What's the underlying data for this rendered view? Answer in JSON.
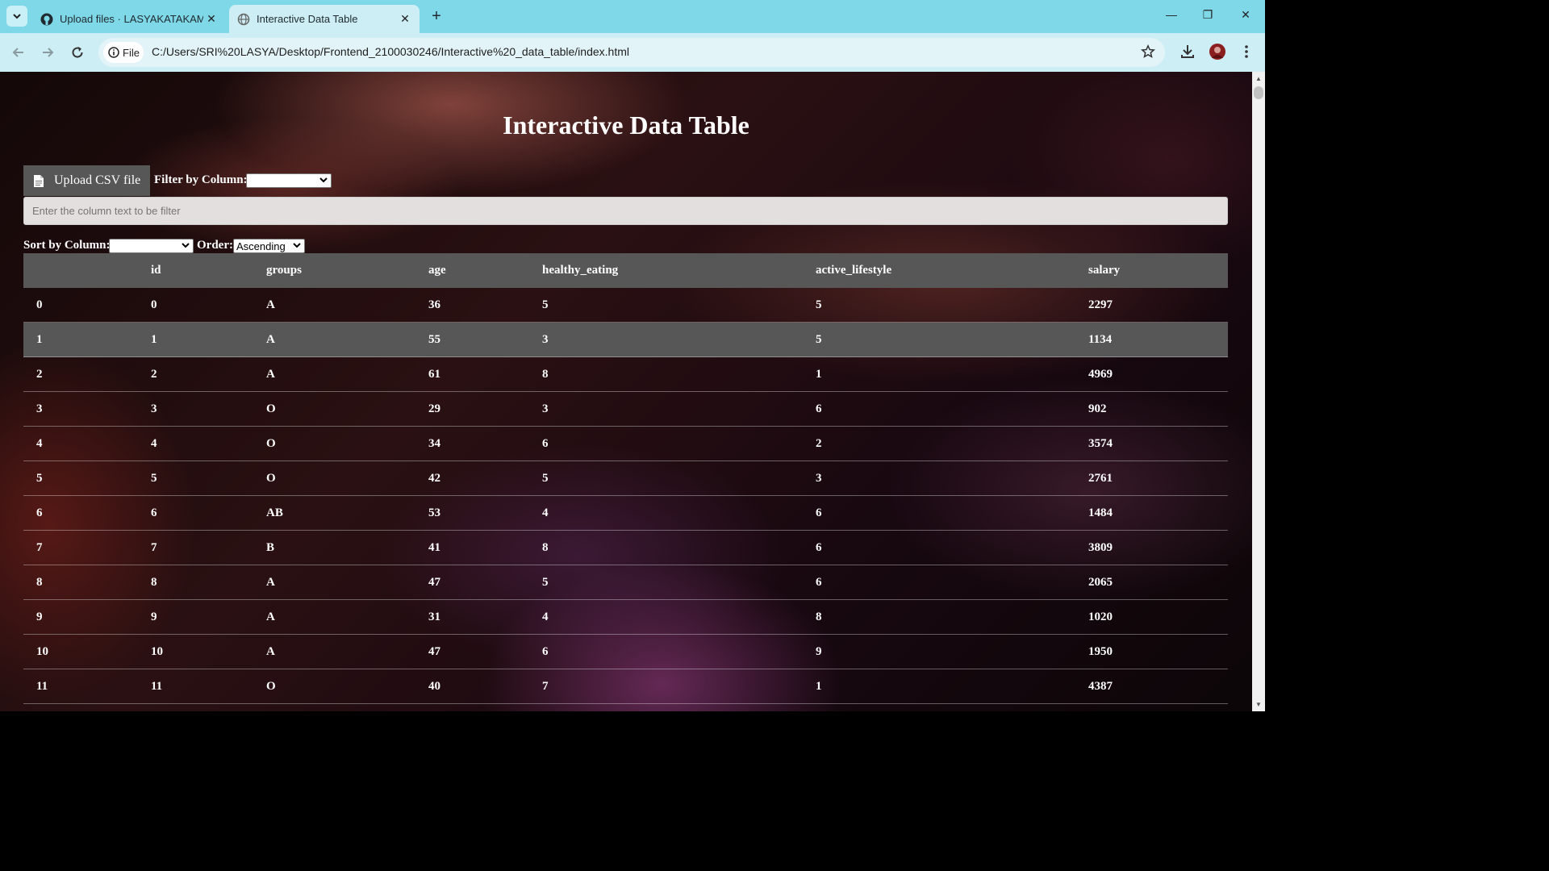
{
  "browser": {
    "tabs": [
      {
        "title": "Upload files · LASYAKATAKAM/F",
        "active": false
      },
      {
        "title": "Interactive Data Table",
        "active": true
      }
    ],
    "address_chip": "File",
    "url": "C:/Users/SRI%20LASYA/Desktop/Frontend_2100030246/Interactive%20_data_table/index.html"
  },
  "page": {
    "title": "Interactive Data Table",
    "upload_label": "Upload CSV file",
    "filter_label": "Filter by Column:",
    "filter_selected": "",
    "filter_placeholder": "Enter the column text to be filter",
    "sort_label": "Sort by Column:",
    "sort_selected": "",
    "order_label": "Order:",
    "order_selected": "Ascending"
  },
  "table": {
    "headers": [
      "",
      "id",
      "groups",
      "age",
      "healthy_eating",
      "active_lifestyle",
      "salary"
    ],
    "rows": [
      [
        "0",
        "0",
        "A",
        "36",
        "5",
        "5",
        "2297"
      ],
      [
        "1",
        "1",
        "A",
        "55",
        "3",
        "5",
        "1134"
      ],
      [
        "2",
        "2",
        "A",
        "61",
        "8",
        "1",
        "4969"
      ],
      [
        "3",
        "3",
        "O",
        "29",
        "3",
        "6",
        "902"
      ],
      [
        "4",
        "4",
        "O",
        "34",
        "6",
        "2",
        "3574"
      ],
      [
        "5",
        "5",
        "O",
        "42",
        "5",
        "3",
        "2761"
      ],
      [
        "6",
        "6",
        "AB",
        "53",
        "4",
        "6",
        "1484"
      ],
      [
        "7",
        "7",
        "B",
        "41",
        "8",
        "6",
        "3809"
      ],
      [
        "8",
        "8",
        "A",
        "47",
        "5",
        "6",
        "2065"
      ],
      [
        "9",
        "9",
        "A",
        "31",
        "4",
        "8",
        "1020"
      ],
      [
        "10",
        "10",
        "A",
        "47",
        "6",
        "9",
        "1950"
      ],
      [
        "11",
        "11",
        "O",
        "40",
        "7",
        "1",
        "4387"
      ]
    ],
    "highlighted_row": 1
  },
  "colors": {
    "tabstrip": "#7fd8e8",
    "toolbar": "#cdeef5",
    "table_header": "#575757",
    "text": "#ffffff"
  }
}
